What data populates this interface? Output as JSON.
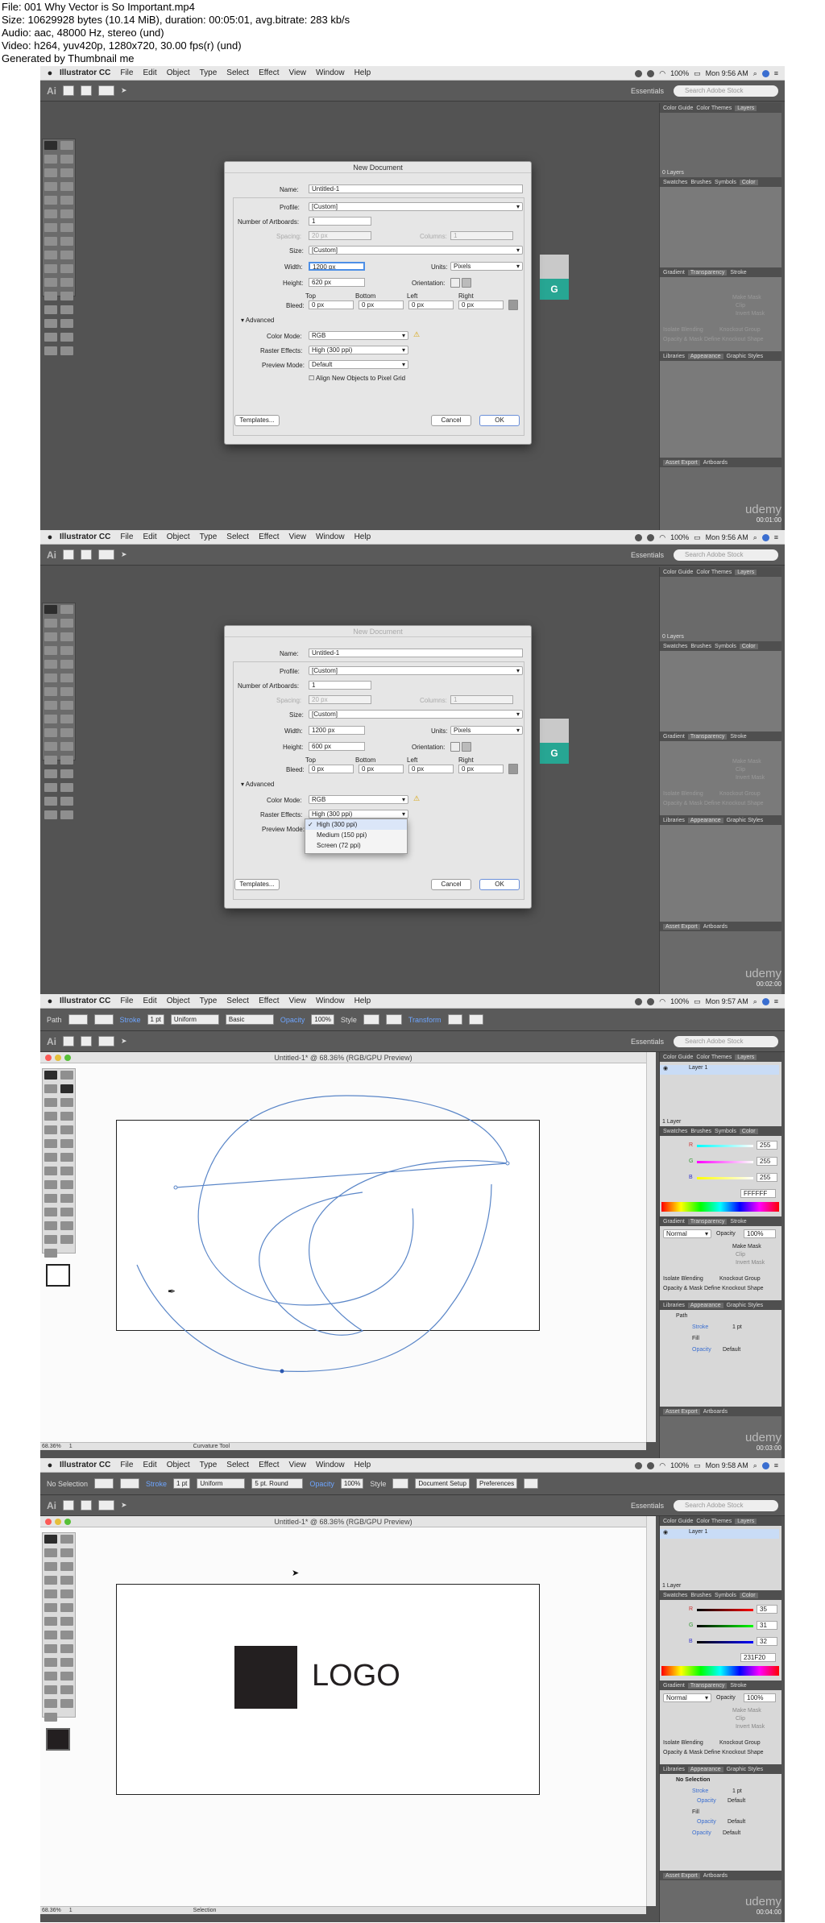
{
  "file_info": {
    "line1": "File: 001 Why Vector is So Important.mp4",
    "line2": "Size: 10629928 bytes (10.14 MiB), duration: 00:05:01, avg.bitrate: 283 kb/s",
    "line3": "Audio: aac, 48000 Hz, stereo (und)",
    "line4": "Video: h264, yuv420p, 1280x720, 30.00 fps(r) (und)",
    "line5": "Generated by Thumbnail me"
  },
  "menu": {
    "apple": "",
    "app": "Illustrator CC",
    "items": [
      "File",
      "Edit",
      "Object",
      "Type",
      "Select",
      "Effect",
      "View",
      "Window",
      "Help"
    ],
    "battery": "100%"
  },
  "frames": [
    {
      "time": "Mon 9:56 AM",
      "timestamp": "00:01:00"
    },
    {
      "time": "Mon 9:56 AM",
      "timestamp": "00:02:00"
    },
    {
      "time": "Mon 9:57 AM",
      "timestamp": "00:03:00"
    },
    {
      "time": "Mon 9:58 AM",
      "timestamp": "00:04:00"
    }
  ],
  "watermark": "udemy",
  "toolbar": {
    "ai_label": "Ai",
    "essentials": "Essentials",
    "search_placeholder": "Search Adobe Stock",
    "path_label": "Path",
    "no_selection": "No Selection",
    "stroke_label": "Stroke",
    "stroke_weight": "1 pt",
    "profile": "Uniform",
    "brush_basic": "Basic",
    "brush_round": "5 pt. Round",
    "opacity_label": "Opacity",
    "opacity_value": "100%",
    "style_label": "Style",
    "transform": "Transform",
    "document_setup": "Document Setup",
    "preferences": "Preferences"
  },
  "panels": {
    "tabs_top": [
      "Color Guide",
      "Color Themes",
      "Layers"
    ],
    "layers_zero": "0 Layers",
    "layers_one": "1 Layer",
    "layer_name": "Layer 1",
    "tabs_swatch": [
      "Swatches",
      "Brushes",
      "Symbols",
      "Color"
    ],
    "tabs_gradient": [
      "Gradient",
      "Transparency",
      "Stroke"
    ],
    "blend_mode": "Normal",
    "opacity_label": "Opacity",
    "opacity_value": "100%",
    "make_mask": "Make Mask",
    "clip": "Clip",
    "invert_mask": "Invert Mask",
    "isolate_blending": "Isolate Blending",
    "knockout_group": "Knockout Group",
    "opacity_mask_define": "Opacity & Mask Define Knockout Shape",
    "tabs_libraries": [
      "Libraries",
      "Appearance",
      "Graphic Styles"
    ],
    "path_label": "Path",
    "stroke_label": "Stroke",
    "stroke_value": "1 pt",
    "fill_label": "Fill",
    "opacity_default": "Default",
    "no_selection": "No Selection",
    "asset_tabs": [
      "Asset Export",
      "Artboards"
    ],
    "rgb_white": {
      "R": "255",
      "G": "255",
      "B": "255",
      "hex": "FFFFFF"
    },
    "rgb_dark": {
      "R": "35",
      "G": "31",
      "B": "32",
      "hex": "231F20"
    }
  },
  "dialog": {
    "title": "New Document",
    "name_label": "Name:",
    "name_value": "Untitled-1",
    "profile_label": "Profile:",
    "profile_value": "[Custom]",
    "artboards_label": "Number of Artboards:",
    "artboards_value": "1",
    "spacing_label": "Spacing:",
    "spacing_value": "20 px",
    "columns_label": "Columns:",
    "columns_value": "1",
    "size_label": "Size:",
    "size_value": "[Custom]",
    "width_label": "Width:",
    "width_value": "1200 px",
    "units_label": "Units:",
    "units_value": "Pixels",
    "height_label": "Height:",
    "height_value_1": "620 px",
    "height_value_2": "600 px",
    "orientation_label": "Orientation:",
    "top_label": "Top",
    "bottom_label": "Bottom",
    "left_label": "Left",
    "right_label": "Right",
    "bleed_label": "Bleed:",
    "bleed_value": "0 px",
    "advanced_label": "Advanced",
    "color_mode_label": "Color Mode:",
    "color_mode_value": "RGB",
    "raster_label": "Raster Effects:",
    "raster_value": "High (300 ppi)",
    "preview_label": "Preview Mode:",
    "preview_value": "Default",
    "align_label": "Align New Objects to Pixel Grid",
    "templates_button": "Templates...",
    "cancel_button": "Cancel",
    "ok_button": "OK",
    "raster_options": [
      "High (300 ppi)",
      "Medium (150 ppi)",
      "Screen (72 ppi)"
    ]
  },
  "document": {
    "title": "Untitled-1* @ 68.36% (RGB/GPU Preview)",
    "zoom": "68.36%",
    "page": "1",
    "tool_curvature": "Curvature Tool",
    "tool_selection": "Selection",
    "logo_text": "LOGO"
  },
  "background_sign": "G"
}
